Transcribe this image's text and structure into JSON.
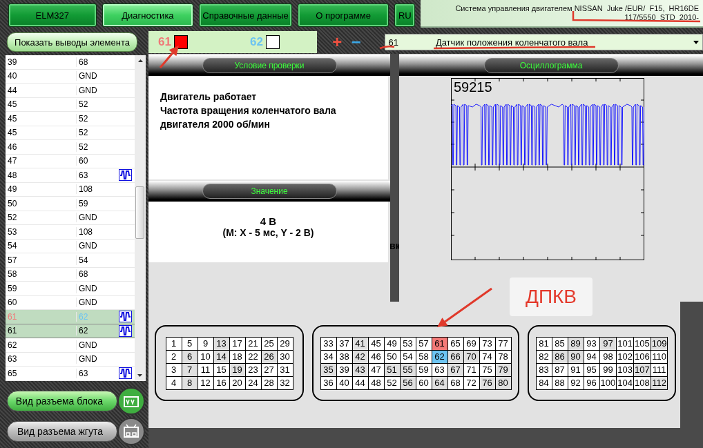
{
  "tabs": [
    {
      "label": "ELM327",
      "selected": false
    },
    {
      "label": "Диагностика",
      "selected": true
    },
    {
      "label": "Справочные данные",
      "selected": false
    },
    {
      "label": "О программе",
      "selected": false
    },
    {
      "label": "RU",
      "selected": false
    }
  ],
  "vehicle": {
    "line_1": "Система управления двигателем NISSAN  Juke /EUR/  F15,  HR16DE",
    "line_2": "117/5550  STD  2010-"
  },
  "show_pins_button": "Показать выводы элемента",
  "probes": [
    {
      "pin": "61",
      "color": "#ff0000"
    },
    {
      "pin": "62",
      "color": "#ffffff"
    }
  ],
  "zoom_controls": [
    {
      "kind": "plus",
      "label": "+"
    },
    {
      "kind": "minus",
      "label": "−"
    }
  ],
  "element_select": {
    "pin": "61",
    "name": "Датчик положения коленчатого вала"
  },
  "pin_list": [
    {
      "pin_1": "39",
      "pin_2": "68",
      "waveform": false,
      "selected": false,
      "probed": false
    },
    {
      "pin_1": "40",
      "pin_2": "GND",
      "waveform": false,
      "selected": false,
      "probed": false
    },
    {
      "pin_1": "44",
      "pin_2": "GND",
      "waveform": false,
      "selected": false,
      "probed": false
    },
    {
      "pin_1": "45",
      "pin_2": "52",
      "waveform": false,
      "selected": false,
      "probed": false
    },
    {
      "pin_1": "45",
      "pin_2": "52",
      "waveform": false,
      "selected": false,
      "probed": false
    },
    {
      "pin_1": "45",
      "pin_2": "52",
      "waveform": false,
      "selected": false,
      "probed": false
    },
    {
      "pin_1": "46",
      "pin_2": "52",
      "waveform": false,
      "selected": false,
      "probed": false
    },
    {
      "pin_1": "47",
      "pin_2": "60",
      "waveform": false,
      "selected": false,
      "probed": false
    },
    {
      "pin_1": "48",
      "pin_2": "63",
      "waveform": true,
      "selected": false,
      "probed": false
    },
    {
      "pin_1": "49",
      "pin_2": "108",
      "waveform": false,
      "selected": false,
      "probed": false
    },
    {
      "pin_1": "50",
      "pin_2": "59",
      "waveform": false,
      "selected": false,
      "probed": false
    },
    {
      "pin_1": "52",
      "pin_2": "GND",
      "waveform": false,
      "selected": false,
      "probed": false
    },
    {
      "pin_1": "53",
      "pin_2": "108",
      "waveform": false,
      "selected": false,
      "probed": false
    },
    {
      "pin_1": "54",
      "pin_2": "GND",
      "waveform": false,
      "selected": false,
      "probed": false
    },
    {
      "pin_1": "57",
      "pin_2": "54",
      "waveform": false,
      "selected": false,
      "probed": false
    },
    {
      "pin_1": "58",
      "pin_2": "68",
      "waveform": false,
      "selected": false,
      "probed": false
    },
    {
      "pin_1": "59",
      "pin_2": "GND",
      "waveform": false,
      "selected": false,
      "probed": false
    },
    {
      "pin_1": "60",
      "pin_2": "GND",
      "waveform": false,
      "selected": false,
      "probed": false
    },
    {
      "pin_1": "61",
      "pin_2": "62",
      "waveform": true,
      "selected": true,
      "probed": true
    },
    {
      "pin_1": "61",
      "pin_2": "62",
      "waveform": true,
      "selected": true,
      "probed": false
    },
    {
      "pin_1": "62",
      "pin_2": "GND",
      "waveform": false,
      "selected": false,
      "probed": false
    },
    {
      "pin_1": "63",
      "pin_2": "GND",
      "waveform": false,
      "selected": false,
      "probed": false
    },
    {
      "pin_1": "65",
      "pin_2": "63",
      "waveform": true,
      "selected": false,
      "probed": false
    }
  ],
  "connector_view_buttons": [
    {
      "label": "Вид разъема блока",
      "selected": true
    },
    {
      "label": "Вид разъема жгута",
      "selected": false
    }
  ],
  "test_condition": {
    "title": "Условие проверки",
    "lines": [
      "Двигатель работает",
      "Частота вращения коленчатого вала",
      "двигателя 2000 об/мин"
    ]
  },
  "value": {
    "title": "Значение",
    "lines": [
      "4 В",
      "(М: X - 5 мс, Y - 2 В)"
    ],
    "hidden_text": "вк"
  },
  "oscillogram": {
    "title": "Осциллограмма",
    "reading": "59215"
  },
  "callout": "ДПКВ",
  "connectors": [
    {
      "rows": [
        [
          {
            "pin": "1",
            "kind": "plain"
          },
          {
            "pin": "5",
            "kind": "plain"
          },
          {
            "pin": "9",
            "kind": "plain"
          },
          {
            "pin": "13",
            "kind": "shaded"
          },
          {
            "pin": "17",
            "kind": "plain"
          },
          {
            "pin": "21",
            "kind": "plain"
          },
          {
            "pin": "25",
            "kind": "plain"
          },
          {
            "pin": "29",
            "kind": "plain"
          }
        ],
        [
          {
            "pin": "2",
            "kind": "plain"
          },
          {
            "pin": "6",
            "kind": "shaded"
          },
          {
            "pin": "10",
            "kind": "plain"
          },
          {
            "pin": "14",
            "kind": "shaded"
          },
          {
            "pin": "18",
            "kind": "plain"
          },
          {
            "pin": "22",
            "kind": "plain"
          },
          {
            "pin": "26",
            "kind": "shaded"
          },
          {
            "pin": "30",
            "kind": "plain"
          }
        ],
        [
          {
            "pin": "3",
            "kind": "plain"
          },
          {
            "pin": "7",
            "kind": "shaded"
          },
          {
            "pin": "11",
            "kind": "plain"
          },
          {
            "pin": "15",
            "kind": "plain"
          },
          {
            "pin": "19",
            "kind": "shaded"
          },
          {
            "pin": "23",
            "kind": "plain"
          },
          {
            "pin": "27",
            "kind": "plain"
          },
          {
            "pin": "31",
            "kind": "plain"
          }
        ],
        [
          {
            "pin": "4",
            "kind": "plain"
          },
          {
            "pin": "8",
            "kind": "shaded"
          },
          {
            "pin": "12",
            "kind": "plain"
          },
          {
            "pin": "16",
            "kind": "plain"
          },
          {
            "pin": "20",
            "kind": "plain"
          },
          {
            "pin": "24",
            "kind": "plain"
          },
          {
            "pin": "28",
            "kind": "plain"
          },
          {
            "pin": "32",
            "kind": "plain"
          }
        ]
      ]
    },
    {
      "rows": [
        [
          {
            "pin": "33",
            "kind": "plain"
          },
          {
            "pin": "37",
            "kind": "plain"
          },
          {
            "pin": "41",
            "kind": "shaded"
          },
          {
            "pin": "45",
            "kind": "plain"
          },
          {
            "pin": "49",
            "kind": "plain"
          },
          {
            "pin": "53",
            "kind": "plain"
          },
          {
            "pin": "57",
            "kind": "plain"
          },
          {
            "pin": "61",
            "kind": "probe_1"
          },
          {
            "pin": "65",
            "kind": "plain"
          },
          {
            "pin": "69",
            "kind": "plain"
          },
          {
            "pin": "73",
            "kind": "plain"
          },
          {
            "pin": "77",
            "kind": "plain"
          }
        ],
        [
          {
            "pin": "34",
            "kind": "plain"
          },
          {
            "pin": "38",
            "kind": "plain"
          },
          {
            "pin": "42",
            "kind": "shaded"
          },
          {
            "pin": "46",
            "kind": "plain"
          },
          {
            "pin": "50",
            "kind": "plain"
          },
          {
            "pin": "54",
            "kind": "plain"
          },
          {
            "pin": "58",
            "kind": "plain"
          },
          {
            "pin": "62",
            "kind": "probe_2"
          },
          {
            "pin": "66",
            "kind": "shaded"
          },
          {
            "pin": "70",
            "kind": "shaded"
          },
          {
            "pin": "74",
            "kind": "plain"
          },
          {
            "pin": "78",
            "kind": "plain"
          }
        ],
        [
          {
            "pin": "35",
            "kind": "shaded"
          },
          {
            "pin": "39",
            "kind": "plain"
          },
          {
            "pin": "43",
            "kind": "shaded"
          },
          {
            "pin": "47",
            "kind": "plain"
          },
          {
            "pin": "51",
            "kind": "shaded"
          },
          {
            "pin": "55",
            "kind": "shaded"
          },
          {
            "pin": "59",
            "kind": "plain"
          },
          {
            "pin": "63",
            "kind": "plain"
          },
          {
            "pin": "67",
            "kind": "shaded"
          },
          {
            "pin": "71",
            "kind": "plain"
          },
          {
            "pin": "75",
            "kind": "plain"
          },
          {
            "pin": "79",
            "kind": "shaded"
          }
        ],
        [
          {
            "pin": "36",
            "kind": "plain"
          },
          {
            "pin": "40",
            "kind": "plain"
          },
          {
            "pin": "44",
            "kind": "plain"
          },
          {
            "pin": "48",
            "kind": "plain"
          },
          {
            "pin": "52",
            "kind": "plain"
          },
          {
            "pin": "56",
            "kind": "shaded"
          },
          {
            "pin": "60",
            "kind": "plain"
          },
          {
            "pin": "64",
            "kind": "shaded"
          },
          {
            "pin": "68",
            "kind": "plain"
          },
          {
            "pin": "72",
            "kind": "plain"
          },
          {
            "pin": "76",
            "kind": "shaded"
          },
          {
            "pin": "80",
            "kind": "shaded"
          }
        ]
      ]
    },
    {
      "rows": [
        [
          {
            "pin": "81",
            "kind": "plain"
          },
          {
            "pin": "85",
            "kind": "plain"
          },
          {
            "pin": "89",
            "kind": "shaded"
          },
          {
            "pin": "93",
            "kind": "plain"
          },
          {
            "pin": "97",
            "kind": "shaded"
          },
          {
            "pin": "101",
            "kind": "plain"
          },
          {
            "pin": "105",
            "kind": "plain"
          },
          {
            "pin": "109",
            "kind": "shaded"
          }
        ],
        [
          {
            "pin": "82",
            "kind": "plain"
          },
          {
            "pin": "86",
            "kind": "shaded"
          },
          {
            "pin": "90",
            "kind": "shaded"
          },
          {
            "pin": "94",
            "kind": "plain"
          },
          {
            "pin": "98",
            "kind": "plain"
          },
          {
            "pin": "102",
            "kind": "plain"
          },
          {
            "pin": "106",
            "kind": "plain"
          },
          {
            "pin": "110",
            "kind": "plain"
          }
        ],
        [
          {
            "pin": "83",
            "kind": "plain"
          },
          {
            "pin": "87",
            "kind": "plain"
          },
          {
            "pin": "91",
            "kind": "plain"
          },
          {
            "pin": "95",
            "kind": "plain"
          },
          {
            "pin": "99",
            "kind": "plain"
          },
          {
            "pin": "103",
            "kind": "plain"
          },
          {
            "pin": "107",
            "kind": "shaded"
          },
          {
            "pin": "111",
            "kind": "plain"
          }
        ],
        [
          {
            "pin": "84",
            "kind": "plain"
          },
          {
            "pin": "88",
            "kind": "plain"
          },
          {
            "pin": "92",
            "kind": "plain"
          },
          {
            "pin": "96",
            "kind": "plain"
          },
          {
            "pin": "100",
            "kind": "plain"
          },
          {
            "pin": "104",
            "kind": "plain"
          },
          {
            "pin": "108",
            "kind": "plain"
          },
          {
            "pin": "112",
            "kind": "shaded"
          }
        ]
      ]
    }
  ]
}
